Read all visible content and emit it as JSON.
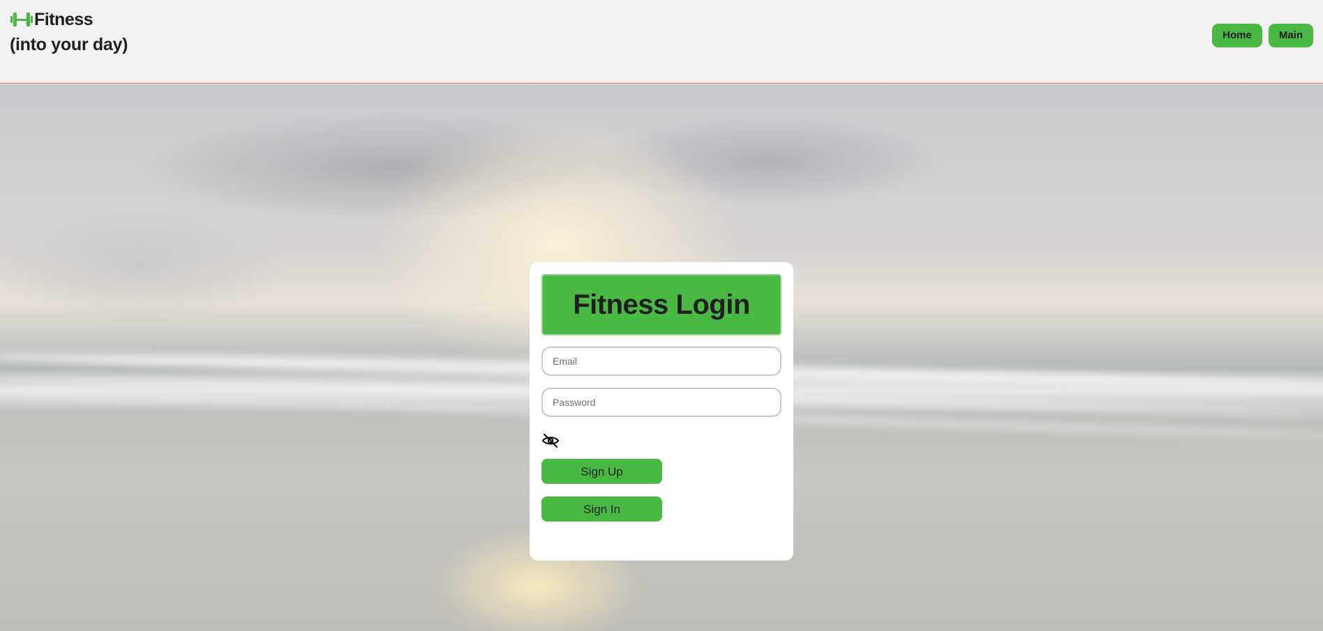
{
  "header": {
    "brand_name": "Fitness",
    "tagline": "(into your day)",
    "logo_icon": "dumbbell-icon",
    "nav": {
      "home_label": "Home",
      "main_label": "Main"
    }
  },
  "login": {
    "title": "Fitness Login",
    "email_placeholder": "Email",
    "email_value": "",
    "password_placeholder": "Password",
    "password_value": "",
    "toggle_icon": "eye-slash-icon",
    "signup_label": "Sign Up",
    "signin_label": "Sign In"
  },
  "colors": {
    "accent_green": "#4ab944",
    "header_bg": "#f2f2f2",
    "header_border": "#e2583e",
    "card_bg": "#ffffff"
  }
}
